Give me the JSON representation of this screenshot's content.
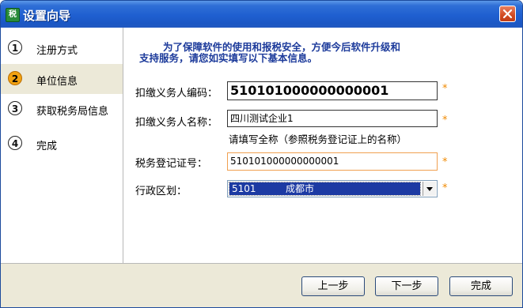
{
  "window": {
    "title": "设置向导",
    "app_icon_glyph": "税",
    "colors": {
      "titlebar": "#1f5fd0",
      "close": "#d14a22",
      "notice": "#1d3b9b",
      "required_star": "#f08a00",
      "selection": "#1c3aa3"
    }
  },
  "sidebar": {
    "steps": [
      {
        "number": "1",
        "label": "注册方式"
      },
      {
        "number": "2",
        "label": "单位信息"
      },
      {
        "number": "3",
        "label": "获取税务局信息"
      },
      {
        "number": "4",
        "label": "完成"
      }
    ]
  },
  "form": {
    "notice_line1": "为了保障软件的使用和报税安全，方便今后软件升级和",
    "notice_line2": "支持服务，请您如实填写以下基本信息。",
    "withholder_code_label": "扣缴义务人编码：",
    "withholder_code_value": "510101000000000001",
    "withholder_name_label": "扣缴义务人名称：",
    "withholder_name_value": "四川测试企业1",
    "name_hint": "请填写全称（参照税务登记证上的名称）",
    "tax_reg_label": "税务登记证号：",
    "tax_reg_value": "510101000000000001",
    "region_label": "行政区划：",
    "region_code": "5101",
    "region_city": "成都市",
    "required_mark": "*"
  },
  "buttons": {
    "prev": "上一步",
    "next": "下一步",
    "finish": "完成"
  }
}
